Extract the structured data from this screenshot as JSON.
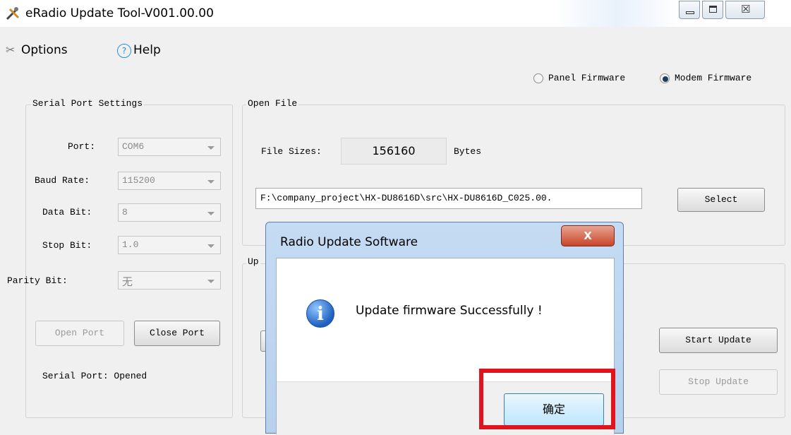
{
  "window": {
    "title": "eRadio Update Tool-V001.00.00"
  },
  "menu": {
    "options": "Options",
    "help": "Help"
  },
  "firmware_type": {
    "panel_label": "Panel Firmware",
    "modem_label": "Modem Firmware",
    "selected": "Modem Firmware"
  },
  "serial": {
    "legend": "Serial Port Settings",
    "port_label": "Port:",
    "port_value": "COM6",
    "baud_label": "Baud Rate:",
    "baud_value": "115200",
    "data_label": "Data Bit:",
    "data_value": "8",
    "stop_label": "Stop Bit:",
    "stop_value": "1.0",
    "parity_label": "Parity Bit:",
    "parity_value": "无",
    "open_button": "Open Port",
    "close_button": "Close Port",
    "status": "Serial Port: Opened"
  },
  "open_file": {
    "legend": "Open File",
    "sizes_label": "File Sizes:",
    "sizes_value": "156160",
    "sizes_unit": "Bytes",
    "path": "F:\\company_project\\HX-DU8616D\\src\\HX-DU8616D_C025.00.",
    "select_button": "Select"
  },
  "update": {
    "legend_partial": "Up",
    "start_button": "Start Update",
    "stop_button": "Stop Update"
  },
  "dialog": {
    "title": "Radio Update Software",
    "message": "Update firmware Successfully !",
    "ok_button": "确定",
    "close_glyph": "X"
  },
  "highlight_color": "#e0141c"
}
